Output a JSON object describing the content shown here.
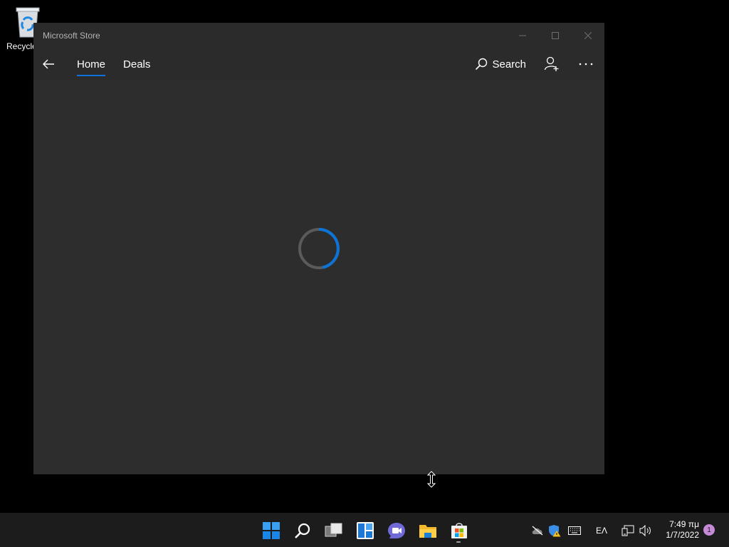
{
  "desktop": {
    "recycle_bin_label": "Recycle"
  },
  "window": {
    "title": "Microsoft Store",
    "tabs": [
      {
        "label": "Home",
        "active": true
      },
      {
        "label": "Deals",
        "active": false
      }
    ],
    "search_label": "Search",
    "loading": true
  },
  "taskbar": {
    "icons": [
      "windows-start",
      "search",
      "task-view",
      "widgets",
      "chat",
      "file-explorer",
      "microsoft-store"
    ],
    "language": "ΕΛ",
    "time": "7:49 πμ",
    "date": "1/7/2022",
    "notification_count": "1"
  },
  "colors": {
    "accent": "#0b74d6",
    "window_bg": "#2b2b2b",
    "taskbar_bg": "#1c1c1c"
  }
}
